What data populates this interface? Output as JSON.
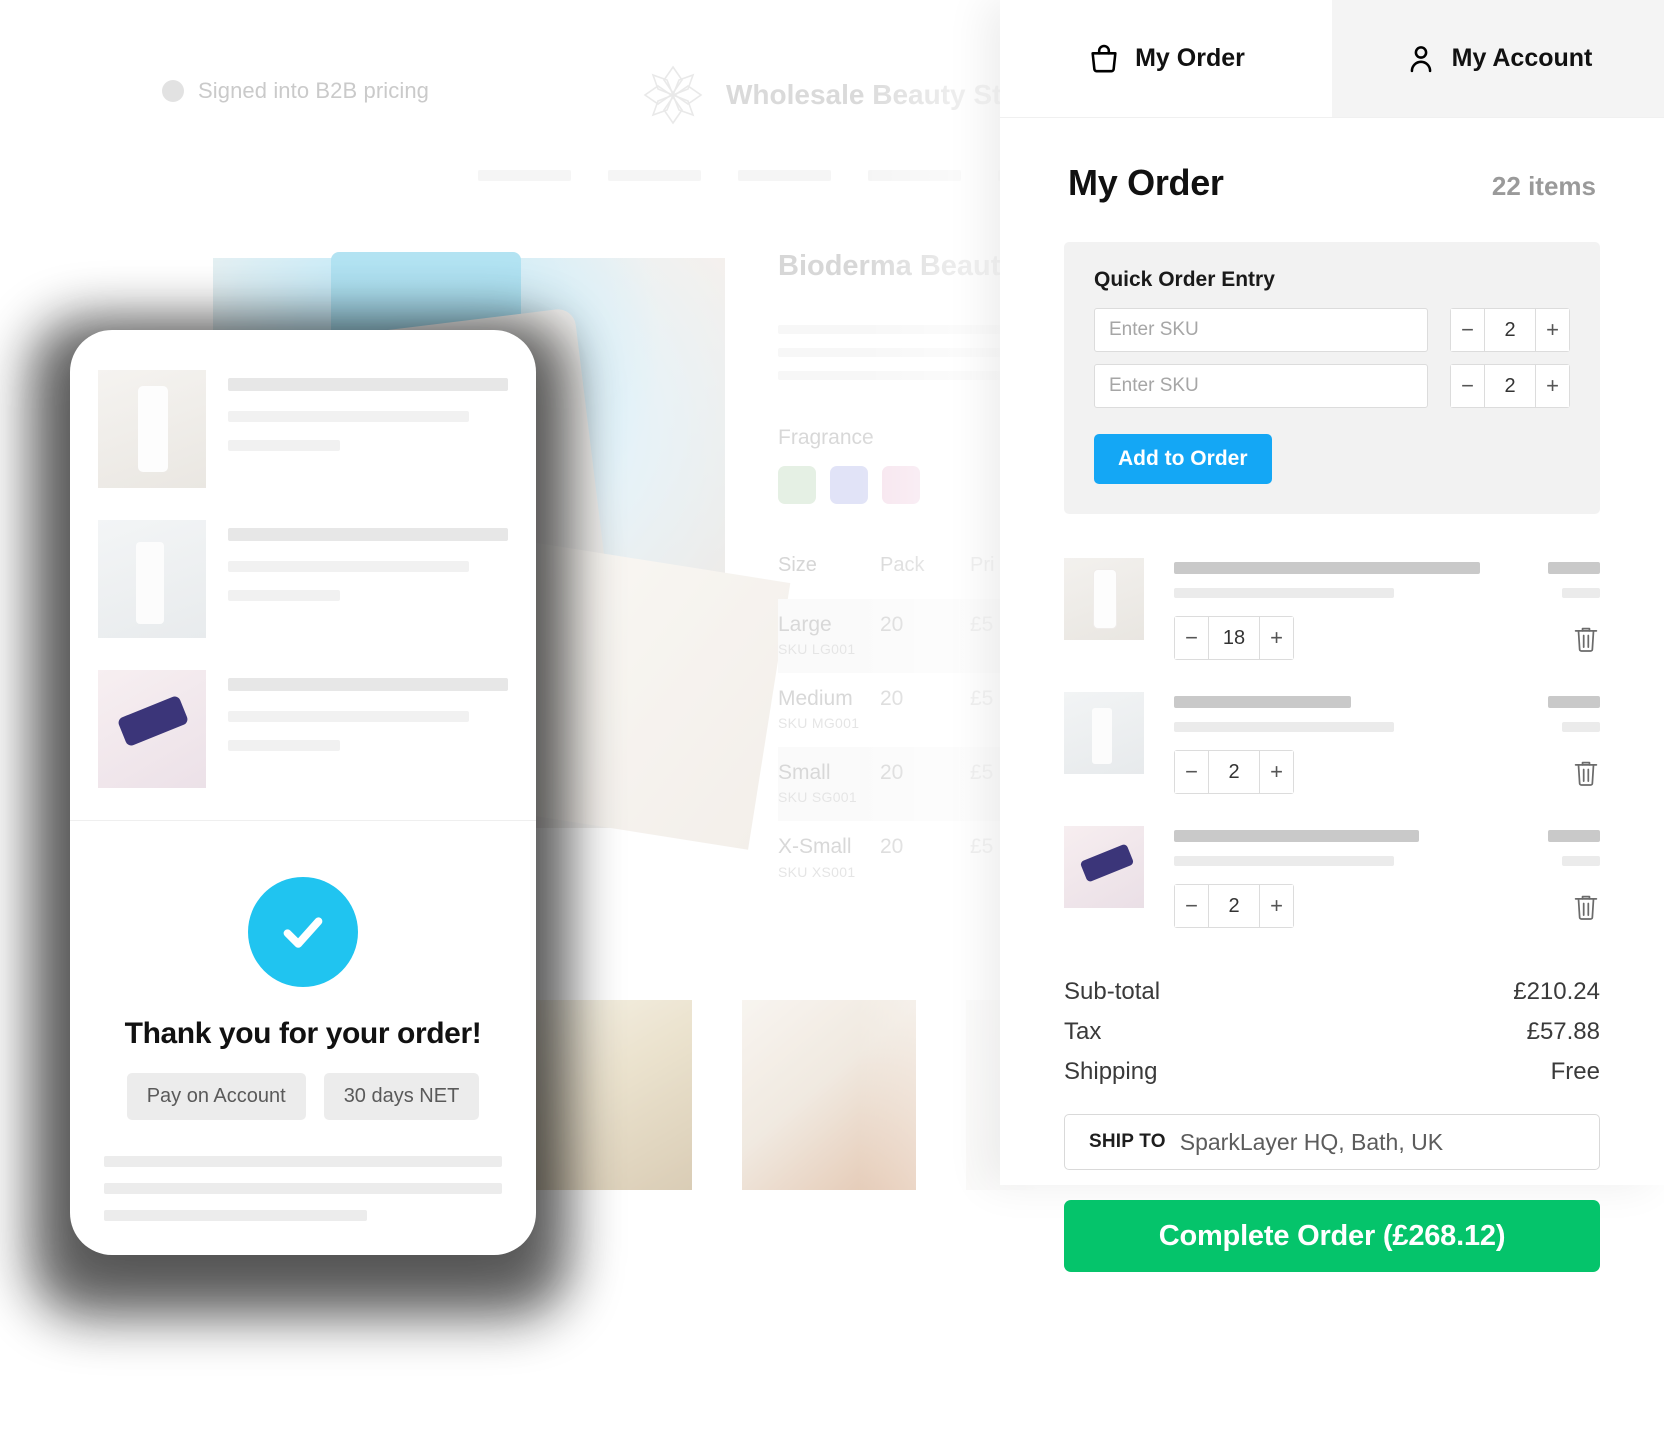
{
  "desktop": {
    "signed_status": "Signed into B2B pricing",
    "brand_name": "Wholesale Beauty St",
    "brand_icon": "flower-logo-icon",
    "product": {
      "title": "Bioderma Beauty C",
      "option_label": "Fragrance",
      "swatches": [
        {
          "name": "green-swatch",
          "color": "#cfe3cc"
        },
        {
          "name": "blue-swatch",
          "color": "#c6cbf0"
        },
        {
          "name": "pink-swatch",
          "color": "#f0cde0"
        }
      ],
      "table": {
        "headers": [
          "Size",
          "Pack",
          "Pri"
        ],
        "rows": [
          {
            "size": "Large",
            "sku": "SKU LG001",
            "pack": "20",
            "price": "£5"
          },
          {
            "size": "Medium",
            "sku": "SKU MG001",
            "pack": "20",
            "price": "£5"
          },
          {
            "size": "Small",
            "sku": "SKU SG001",
            "pack": "20",
            "price": "£5"
          },
          {
            "size": "X-Small",
            "sku": "SKU XS001",
            "pack": "20",
            "price": "£5"
          }
        ]
      }
    }
  },
  "panel": {
    "tabs": [
      {
        "label": "My Order",
        "icon": "shopping-bag-icon",
        "active": false
      },
      {
        "label": "My Account",
        "icon": "user-icon",
        "active": true
      }
    ],
    "title": "My Order",
    "item_count": "22 items",
    "quick_order": {
      "title": "Quick Order Entry",
      "rows": [
        {
          "placeholder": "Enter SKU",
          "qty": "2"
        },
        {
          "placeholder": "Enter SKU",
          "qty": "2"
        }
      ],
      "add_button": "Add to Order",
      "minus_icon": "minus-icon",
      "plus_icon": "plus-icon",
      "accent_color": "#14a7f5"
    },
    "cart_items": [
      {
        "qty": "18",
        "thumb": "lotion-bottle-thumb",
        "delete_icon": "trash-icon"
      },
      {
        "qty": "2",
        "thumb": "cocooil-bottle-thumb",
        "delete_icon": "trash-icon"
      },
      {
        "qty": "2",
        "thumb": "purple-tube-thumb",
        "delete_icon": "trash-icon"
      }
    ],
    "totals": [
      {
        "label": "Sub-total",
        "value": "£210.24"
      },
      {
        "label": "Tax",
        "value": "£57.88"
      },
      {
        "label": "Shipping",
        "value": "Free"
      }
    ],
    "ship_to": {
      "label": "SHIP TO",
      "value": "SparkLayer HQ, Bath, UK"
    },
    "complete_button": "Complete Order (£268.12)",
    "complete_color": "#05c46b"
  },
  "phone": {
    "success_icon": "check-circle-icon",
    "success_color": "#20c4f0",
    "title": "Thank you for your order!",
    "badges": [
      "Pay on Account",
      "30 days NET"
    ]
  }
}
